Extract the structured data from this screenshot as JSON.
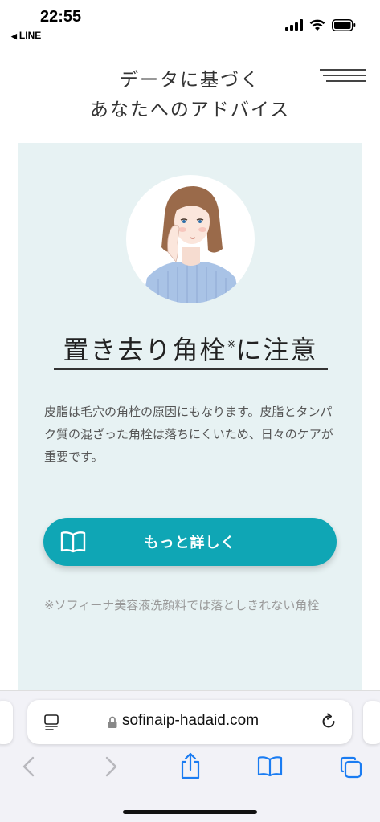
{
  "status_bar": {
    "time": "22:55",
    "back_app": "LINE",
    "icons": [
      "signal-icon",
      "wifi-icon",
      "battery-icon"
    ]
  },
  "header": {
    "title_line1": "データに基づく",
    "title_line2": "あなたへのアドバイス",
    "menu_icon": "hamburger-menu-icon"
  },
  "card": {
    "background": "#e7f2f3",
    "headline_main": "置き去り角栓",
    "headline_mark": "※",
    "headline_tail": "に注意",
    "body": "皮脂は毛穴の角栓の原因にもなります。皮脂とタンパク質の混ざった角栓は落ちにくいため、日々のケアが重要です。",
    "button_label": "もっと詳しく",
    "button_icon": "book-icon",
    "button_color": "#0fa6b5",
    "footnote": "※ソフィーナ美容液洗顔料では落としきれない角栓"
  },
  "browser": {
    "url": "sofinaip-hadaid.com",
    "accent": "#1a7cf2",
    "icons": [
      "page-icon",
      "lock-icon",
      "reload-icon",
      "back-icon",
      "forward-icon",
      "share-icon",
      "bookmarks-icon",
      "tabs-icon"
    ]
  }
}
